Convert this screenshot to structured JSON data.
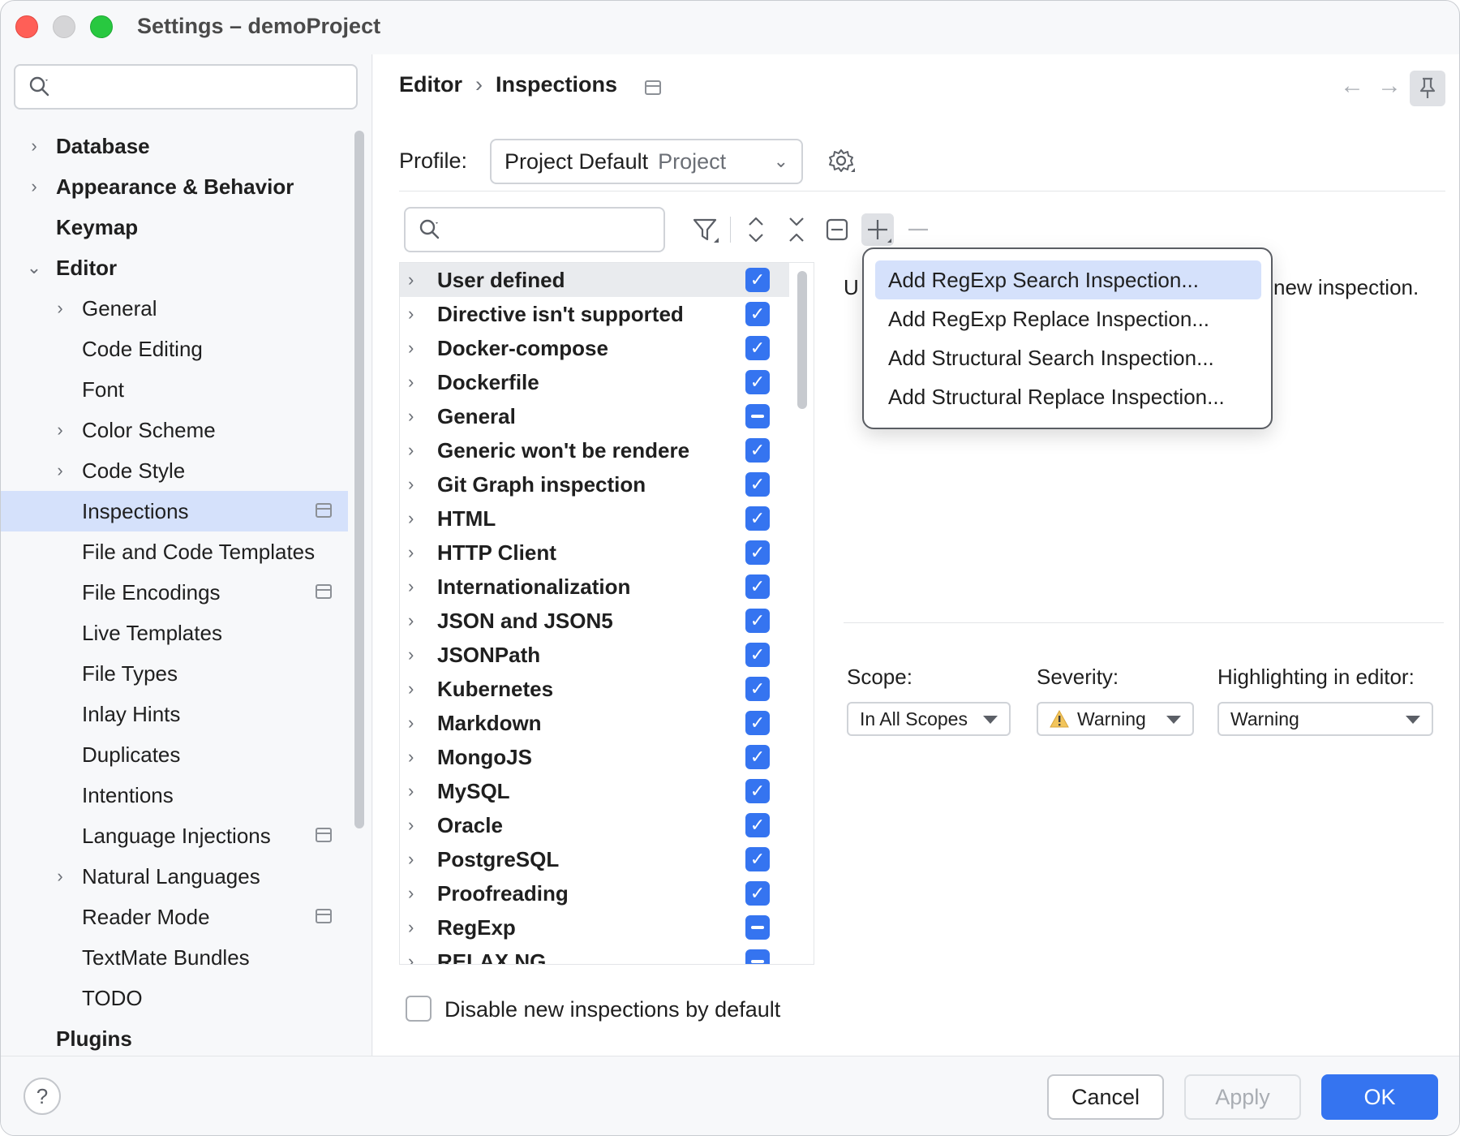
{
  "window": {
    "title": "Settings – demoProject"
  },
  "sidebar": {
    "search": {
      "placeholder": ""
    },
    "items": [
      {
        "label": "Database",
        "level": 0,
        "expandable": true,
        "expanded": false
      },
      {
        "label": "Appearance & Behavior",
        "level": 0,
        "expandable": true,
        "expanded": false
      },
      {
        "label": "Keymap",
        "level": 0,
        "expandable": false
      },
      {
        "label": "Editor",
        "level": 0,
        "expandable": true,
        "expanded": true
      },
      {
        "label": "General",
        "level": 1,
        "expandable": true,
        "expanded": false
      },
      {
        "label": "Code Editing",
        "level": 1,
        "expandable": false
      },
      {
        "label": "Font",
        "level": 1,
        "expandable": false
      },
      {
        "label": "Color Scheme",
        "level": 1,
        "expandable": true,
        "expanded": false
      },
      {
        "label": "Code Style",
        "level": 1,
        "expandable": true,
        "expanded": false
      },
      {
        "label": "Inspections",
        "level": 1,
        "expandable": false,
        "selected": true,
        "project_icon": true
      },
      {
        "label": "File and Code Templates",
        "level": 1,
        "expandable": false
      },
      {
        "label": "File Encodings",
        "level": 1,
        "expandable": false,
        "project_icon": true
      },
      {
        "label": "Live Templates",
        "level": 1,
        "expandable": false
      },
      {
        "label": "File Types",
        "level": 1,
        "expandable": false
      },
      {
        "label": "Inlay Hints",
        "level": 1,
        "expandable": false
      },
      {
        "label": "Duplicates",
        "level": 1,
        "expandable": false
      },
      {
        "label": "Intentions",
        "level": 1,
        "expandable": false
      },
      {
        "label": "Language Injections",
        "level": 1,
        "expandable": false,
        "project_icon": true
      },
      {
        "label": "Natural Languages",
        "level": 1,
        "expandable": true,
        "expanded": false
      },
      {
        "label": "Reader Mode",
        "level": 1,
        "expandable": false,
        "project_icon": true
      },
      {
        "label": "TextMate Bundles",
        "level": 1,
        "expandable": false
      },
      {
        "label": "TODO",
        "level": 1,
        "expandable": false
      },
      {
        "label": "Plugins",
        "level": 0,
        "expandable": false
      }
    ]
  },
  "header": {
    "breadcrumb": [
      "Editor",
      "Inspections"
    ],
    "separator": "›"
  },
  "profile": {
    "label": "Profile:",
    "value": "Project Default",
    "scope": "Project"
  },
  "inspections": {
    "search": {
      "placeholder": ""
    },
    "rows": [
      {
        "label": "User defined",
        "state": "checked",
        "selected": true
      },
      {
        "label": "Directive isn't supported",
        "state": "checked"
      },
      {
        "label": "Docker-compose",
        "state": "checked"
      },
      {
        "label": "Dockerfile",
        "state": "checked"
      },
      {
        "label": "General",
        "state": "partial"
      },
      {
        "label": "Generic won't be rendere",
        "state": "checked"
      },
      {
        "label": "Git Graph inspection",
        "state": "checked"
      },
      {
        "label": "HTML",
        "state": "checked"
      },
      {
        "label": "HTTP Client",
        "state": "checked"
      },
      {
        "label": "Internationalization",
        "state": "checked"
      },
      {
        "label": "JSON and JSON5",
        "state": "checked"
      },
      {
        "label": "JSONPath",
        "state": "checked"
      },
      {
        "label": "Kubernetes",
        "state": "checked"
      },
      {
        "label": "Markdown",
        "state": "checked"
      },
      {
        "label": "MongoJS",
        "state": "checked"
      },
      {
        "label": "MySQL",
        "state": "checked"
      },
      {
        "label": "Oracle",
        "state": "checked"
      },
      {
        "label": "PostgreSQL",
        "state": "checked"
      },
      {
        "label": "Proofreading",
        "state": "checked"
      },
      {
        "label": "RegExp",
        "state": "partial"
      },
      {
        "label": "RELAX NG",
        "state": "partial"
      }
    ],
    "disable_new_label": "Disable new inspections by default"
  },
  "detail": {
    "description_start": "U",
    "description_end": "new inspection.",
    "scope_label": "Scope:",
    "scope_value": "In All Scopes",
    "severity_label": "Severity:",
    "severity_value": "Warning",
    "highlight_label": "Highlighting in editor:",
    "highlight_value": "Warning"
  },
  "popup_menu": {
    "items": [
      {
        "label": "Add RegExp Search Inspection...",
        "highlighted": true
      },
      {
        "label": "Add RegExp Replace Inspection..."
      },
      {
        "label": "Add Structural Search Inspection..."
      },
      {
        "label": "Add Structural Replace Inspection..."
      }
    ]
  },
  "footer": {
    "help": "?",
    "cancel": "Cancel",
    "apply": "Apply",
    "ok": "OK"
  },
  "colors": {
    "accent": "#3574f0",
    "selection": "#d5e1fb",
    "warning": "#f2c55c"
  },
  "icons": [
    "search-icon",
    "filter-icon",
    "expand-all-icon",
    "collapse-all-icon",
    "reset-icon",
    "add-icon",
    "remove-icon",
    "gear-icon",
    "pin-icon",
    "back-arrow-icon",
    "forward-arrow-icon",
    "warning-icon",
    "chevron-right-icon",
    "chevron-down-icon"
  ]
}
